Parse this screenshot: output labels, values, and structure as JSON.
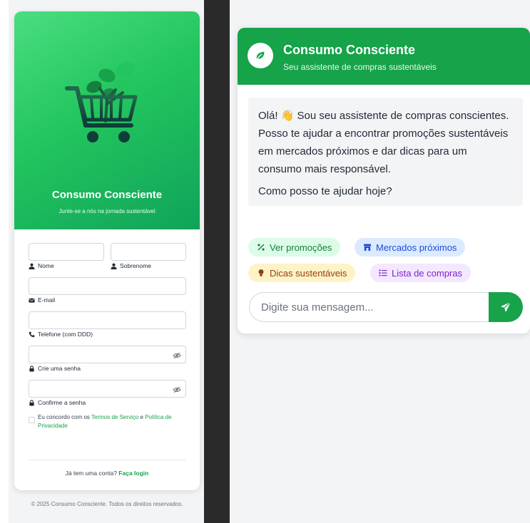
{
  "signup": {
    "brand_title": "Consumo Consciente",
    "brand_tagline": "Junte-se a nós na jornada sustentável",
    "fields": {
      "first_name_label": "Nome",
      "last_name_label": "Sobrenome",
      "email_label": "E-mail",
      "phone_label": "Telefone (com DDD)",
      "password_label": "Crie uma senha",
      "confirm_label": "Confirme a senha"
    },
    "terms": {
      "prefix": "Eu concordo com os ",
      "terms_link": "Termos de Serviço",
      "middle": " e ",
      "privacy_link": "Política de Privacidade"
    },
    "login_prompt": "Já tem uma conta? ",
    "login_link": "Faça login",
    "footer": "© 2025 Consumo Consciente. Todos os direitos reservados."
  },
  "chat": {
    "title": "Consumo Consciente",
    "subtitle": "Seu assistente de compras sustentáveis",
    "greeting_prefix": "Olá! ",
    "greeting_emoji": "👋",
    "greeting_rest": " Sou seu assistente de compras conscientes. Posso te ajudar a encontrar promoções sustentáveis em mercados próximos e dar dicas para um consumo mais responsável.",
    "question": "Como posso te ajudar hoje?",
    "chips": [
      "Ver promoções",
      "Mercados próximos",
      "Dicas sustentáveis",
      "Lista de compras"
    ],
    "input_placeholder": "Digite sua mensagem..."
  },
  "colors": {
    "accent": "#16a34a",
    "hero_gradient_start": "#4ade80",
    "hero_gradient_end": "#10a35a"
  },
  "icons": {
    "logo": "shopping-cart-leaf-icon",
    "avatar": "leaf-icon",
    "send": "paper-plane-icon"
  }
}
